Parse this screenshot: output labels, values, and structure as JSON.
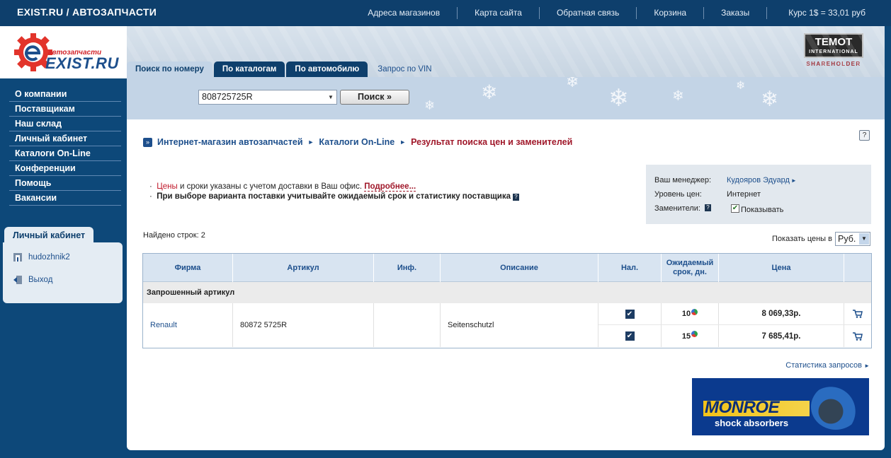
{
  "topbar": {
    "site_title": "EXIST.RU / АВТОЗАПЧАСТИ",
    "nav": [
      "Адреса магазинов",
      "Карта сайта",
      "Обратная связь",
      "Корзина",
      "Заказы"
    ],
    "rate": "Курс 1$ = 33,01 руб"
  },
  "logo": {
    "small": "автозапчасти",
    "big": "EXIST.RU"
  },
  "partner": {
    "name": "TEMOT",
    "sub": "INTERNATIONAL",
    "tagline": "SHAREHOLDER"
  },
  "sidebar": {
    "menu": [
      "О компании",
      "Поставщикам",
      "Наш склад",
      "Личный кабинет",
      "Каталоги On-Line",
      "Конференции",
      "Помощь",
      "Вакансии"
    ],
    "cabinet_title": "Личный кабинет",
    "user": "hudozhnik2",
    "logout": "Выход"
  },
  "tabs": [
    "Поиск по номеру",
    "По каталогам",
    "По автомобилю",
    "Запрос по VIN"
  ],
  "search": {
    "value": "808725725R",
    "button": "Поиск »"
  },
  "breadcrumb": [
    "Интернет-магазин автозапчастей",
    "Каталоги On-Line",
    "Результат поиска цен и заменителей"
  ],
  "notes": {
    "line1_red": "Цены",
    "line1_rest": " и сроки указаны с учетом доставки в Ваш офис. ",
    "line1_more": "Подробнее...",
    "line2": "При выборе варианта поставки учитывайте ожидаемый срок и статистику поставщика"
  },
  "manager": {
    "manager_label": "Ваш менеджер:",
    "manager_name": "Кудояров Эдуард",
    "level_label": "Уровень цен:",
    "level_value": "Интернет",
    "subs_label": "Заменители:",
    "subs_value": "Показывать"
  },
  "found": "Найдено строк: 2",
  "price_in": {
    "label": "Показать цены в",
    "currency": "Руб."
  },
  "table": {
    "headers": [
      "Фирма",
      "Артикул",
      "Инф.",
      "Описание",
      "Нал.",
      "Ожидаемый срок, дн.",
      "Цена"
    ],
    "group": "Запрошенный артикул",
    "firm": "Renault",
    "article": "80872 5725R",
    "description": "Seitenschutzl",
    "rows": [
      {
        "term": "10",
        "price": "8 069,33р."
      },
      {
        "term": "15",
        "price": "7 685,41р."
      }
    ]
  },
  "stats_link": "Статистика запросов",
  "banner": {
    "title": "MONROE",
    "subtitle": "shock absorbers"
  }
}
